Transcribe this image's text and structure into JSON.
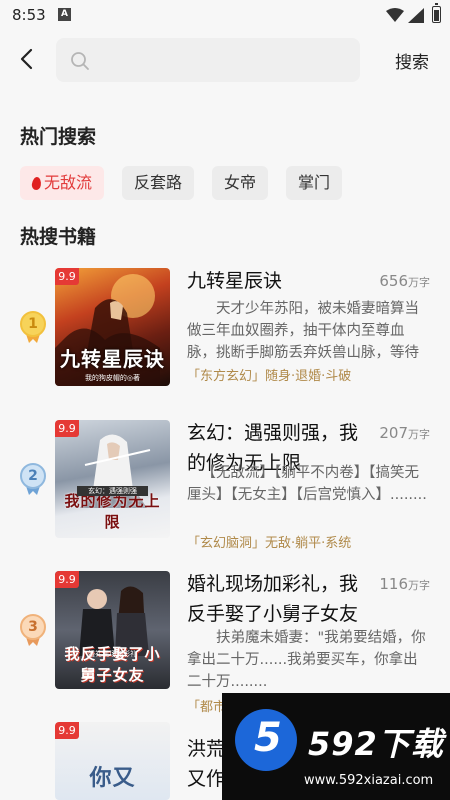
{
  "status_bar": {
    "time": "8:53",
    "notification_glyph": "A"
  },
  "search": {
    "placeholder": "",
    "value": "",
    "button_label": "搜索"
  },
  "hot_search": {
    "title": "热门搜索",
    "tags": [
      {
        "label": "无敌流",
        "hot": true
      },
      {
        "label": "反套路",
        "hot": false
      },
      {
        "label": "女帝",
        "hot": false
      },
      {
        "label": "掌门",
        "hot": false
      }
    ]
  },
  "hot_books": {
    "title": "热搜书籍",
    "books": [
      {
        "rank": "1",
        "badge": "9.9",
        "cover_title": "九转星辰诀",
        "cover_author": "我的狗皮帽的◎著",
        "title": "九转星辰诀",
        "words_number": "656",
        "words_unit": "万字",
        "desc": "天才少年苏阳，被未婚妻暗算当做三年血奴圈养，抽干体内至尊血脉，挑断手脚筋丢弃妖兽山脉，等待死...",
        "meta": "「东方玄幻」随身·退婚·斗破"
      },
      {
        "rank": "2",
        "badge": "9.9",
        "cover_title": "我的修为无上限",
        "cover_author": "玄幻：遇强则强",
        "title": "玄幻：遇强则强，我的修为无上限",
        "words_number": "207",
        "words_unit": "万字",
        "desc": "【无敌流】【躺平不内卷】【搞笑无厘头】【无女主】【后宫党慎入】........",
        "meta": "「玄幻脑洞」无敌·躺平·系统"
      },
      {
        "rank": "3",
        "badge": "9.9",
        "cover_title": "我反手娶了小舅子女友",
        "cover_author": "婚礼现场加彩礼",
        "title": "婚礼现场加彩礼，我反手娶了小舅子女友",
        "words_number": "116",
        "words_unit": "万字",
        "desc": "扶弟魔未婚妻：\"我弟要结婚，你拿出二十万......我弟要买车，你拿出二十万........",
        "meta": "「都市"
      },
      {
        "rank": "",
        "badge": "9.9",
        "cover_title": "你又",
        "cover_author": "",
        "title": "洪荒",
        "title_line2": "又作",
        "words_number": "",
        "words_unit": "",
        "desc": "",
        "meta": ""
      }
    ]
  },
  "watermark": {
    "logo_text": "5",
    "brand": "592下载",
    "site": "www.592xiazai.com"
  },
  "colors": {
    "accent": "#e23b3b",
    "meta": "#b08a4a",
    "gold": "#f2c13d",
    "silver": "#8fb8de",
    "bronze": "#f0b27a"
  }
}
